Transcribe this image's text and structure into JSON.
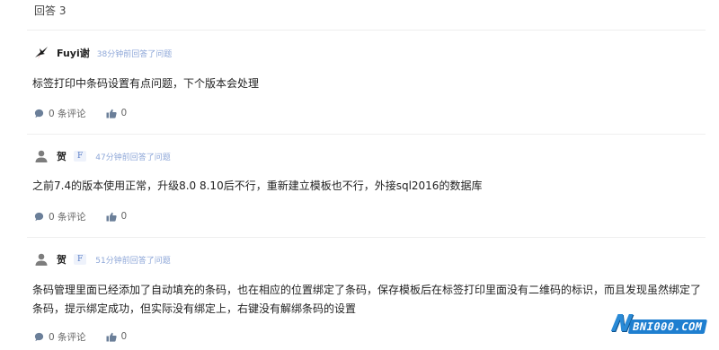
{
  "header": {
    "count_label": "回答 3"
  },
  "answers": [
    {
      "author": "Fuyi谢",
      "badge": "",
      "time": "38分钟前回答了问题",
      "content": "标签打印中条码设置有点问题，下个版本会处理",
      "comments_label": "0 条评论",
      "likes": "0",
      "avatar_icon": "swallow-logo-icon"
    },
    {
      "author": "贺",
      "badge": "F",
      "time": "47分钟前回答了问题",
      "content": "之前7.4的版本使用正常，升级8.0 8.10后不行，重新建立模板也不行，外接sql2016的数据库",
      "comments_label": "0 条评论",
      "likes": "0",
      "avatar_icon": "user-silhouette-icon"
    },
    {
      "author": "贺",
      "badge": "F",
      "time": "51分钟前回答了问题",
      "content": "条码管理里面已经添加了自动填充的条码，也在相应的位置绑定了条码，保存模板后在标签打印里面没有二维码的标识，而且发现虽然绑定了条码，提示绑定成功，但实际没有绑定上，右键没有解绑条码的设置",
      "comments_label": "0 条评论",
      "likes": "0",
      "avatar_icon": "user-silhouette-icon"
    }
  ],
  "watermark": {
    "initial": "N",
    "text": "BNI000.COM"
  },
  "colors": {
    "time_link": "#8ea7d8",
    "badge_bg": "#eef2fb",
    "badge_text": "#5b7fc7",
    "watermark_blue": "#1f7fd0"
  }
}
